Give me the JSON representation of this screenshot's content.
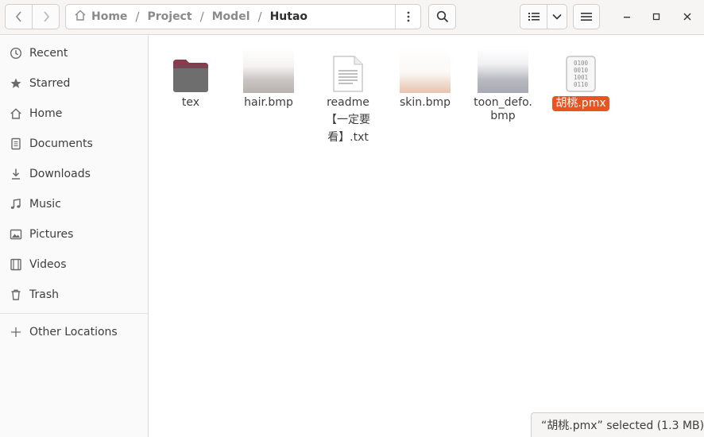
{
  "pathbar": {
    "segments": [
      "Home",
      "Project",
      "Model",
      "Hutao"
    ],
    "separator": "/"
  },
  "sidebar": {
    "items": [
      {
        "label": "Recent",
        "icon": "clock-icon"
      },
      {
        "label": "Starred",
        "icon": "star-icon"
      },
      {
        "label": "Home",
        "icon": "home-icon"
      },
      {
        "label": "Documents",
        "icon": "document-icon"
      },
      {
        "label": "Downloads",
        "icon": "download-icon"
      },
      {
        "label": "Music",
        "icon": "music-icon"
      },
      {
        "label": "Pictures",
        "icon": "picture-icon"
      },
      {
        "label": "Videos",
        "icon": "video-icon"
      },
      {
        "label": "Trash",
        "icon": "trash-icon"
      }
    ],
    "other": {
      "label": "Other Locations",
      "icon": "plus-icon"
    }
  },
  "files": [
    {
      "name": "tex",
      "type": "folder",
      "icon": "folder-icon"
    },
    {
      "name": "hair.bmp",
      "type": "image",
      "icon": "image-thumbnail"
    },
    {
      "name_lines": [
        "readme",
        "【一定要",
        "看】.txt"
      ],
      "type": "text",
      "icon": "text-file-icon"
    },
    {
      "name": "skin.bmp",
      "type": "image",
      "icon": "image-thumbnail"
    },
    {
      "name_lines": [
        "toon_defo.",
        "bmp"
      ],
      "type": "image",
      "icon": "image-thumbnail"
    },
    {
      "name": "胡桃.pmx",
      "type": "binary",
      "icon": "binary-file-icon",
      "selected": true
    }
  ],
  "status": {
    "text": "“胡桃.pmx” selected  (1.3 MB)"
  },
  "colors": {
    "accent": "#e95420",
    "folder": "#8a3a4a"
  }
}
